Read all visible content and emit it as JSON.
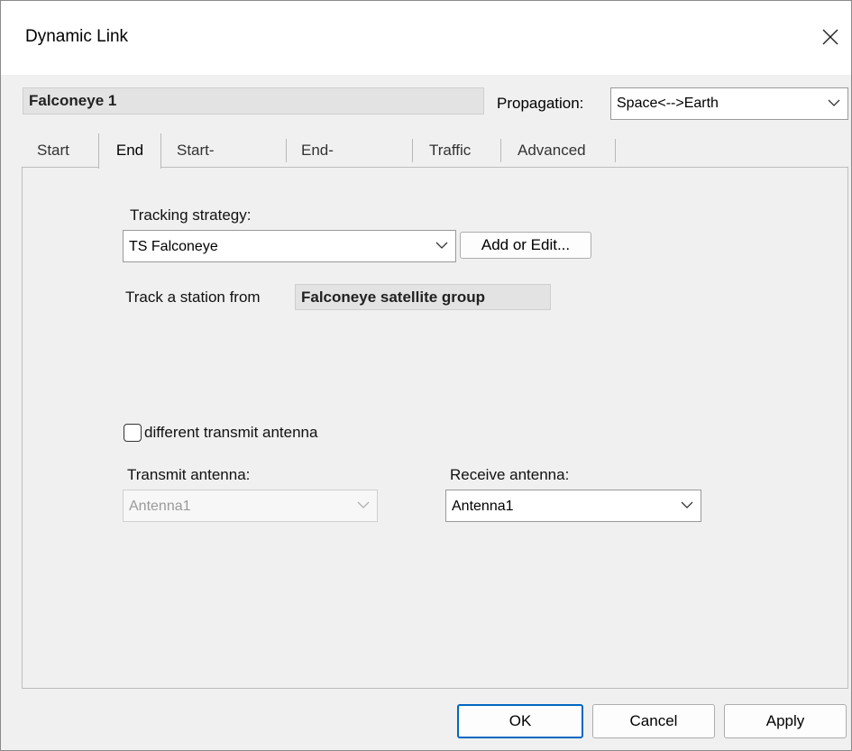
{
  "window": {
    "title": "Dynamic Link"
  },
  "header": {
    "link_name": "Falconeye 1",
    "propagation_label": "Propagation:",
    "propagation_value": "Space<-->Earth"
  },
  "tabs": [
    {
      "label": "Start",
      "active": false
    },
    {
      "label": "End",
      "active": true
    },
    {
      "label": "Start->End",
      "active": false
    },
    {
      "label": "End->Start",
      "active": false
    },
    {
      "label": "Traffic",
      "active": false
    },
    {
      "label": "Advanced",
      "active": false
    }
  ],
  "end_tab": {
    "tracking_strategy_label": "Tracking strategy:",
    "tracking_strategy_value": "TS Falconeye",
    "add_edit_label": "Add or Edit...",
    "track_station_label": "Track a station from",
    "satellite_group": "Falconeye satellite group",
    "different_tx_label": "different transmit antenna",
    "different_tx_checked": false,
    "transmit_antenna_label": "Transmit antenna:",
    "transmit_antenna_value": "Antenna1",
    "receive_antenna_label": "Receive antenna:",
    "receive_antenna_value": "Antenna1"
  },
  "footer": {
    "ok_label": "OK",
    "cancel_label": "Cancel",
    "apply_label": "Apply"
  },
  "icons": {
    "close": "close-icon",
    "dropdown": "chevron-down-icon"
  },
  "colors": {
    "default_button_border": "#0067c0",
    "background": "#f0f0f0"
  }
}
